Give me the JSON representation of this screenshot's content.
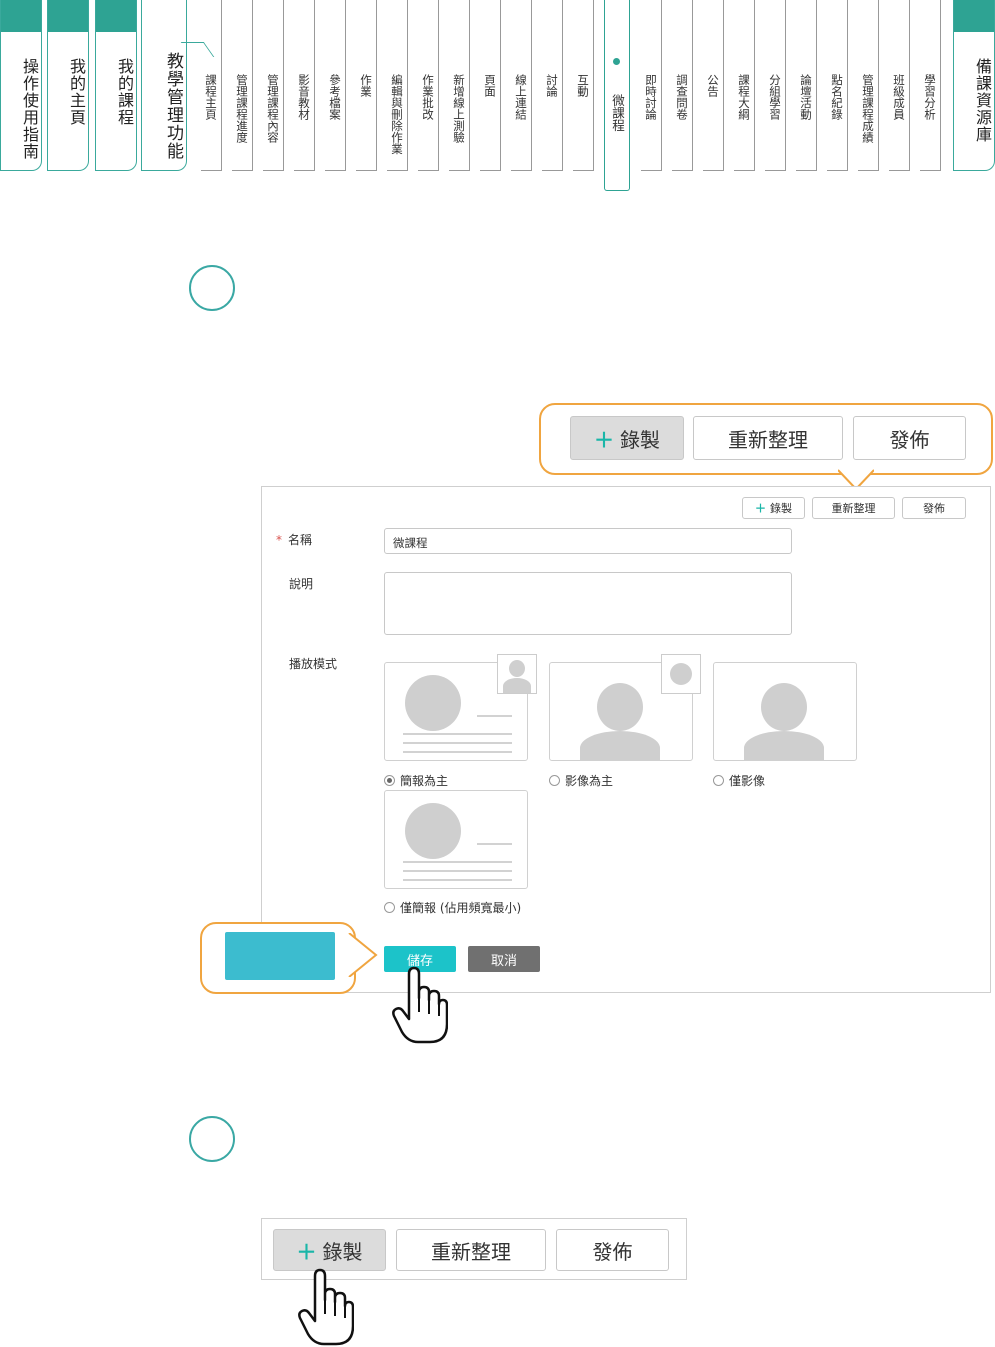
{
  "nav": {
    "main_tabs": [
      "操作使用指南",
      "我的主頁",
      "我的課程",
      "教學管理功能"
    ],
    "sub_tabs": [
      "課程主頁",
      "管理課程進度",
      "管理課程內容",
      "影音教材",
      "參考檔案",
      "作業",
      "編輯與刪除作業",
      "作業批改",
      "新增線上測驗",
      "頁面",
      "線上連結",
      "討論",
      "互動",
      "微課程",
      "即時討論",
      "調查問卷",
      "公告",
      "課程大綱",
      "分組學習",
      "論壇活動",
      "點名紀錄",
      "管理課程成績",
      "班級成員",
      "學習分析"
    ],
    "selected_sub_tab": "微課程",
    "right_tab": "備課資源庫"
  },
  "toolbar": {
    "record": "錄製",
    "reorganize": "重新整理",
    "publish": "發佈"
  },
  "form": {
    "name_label": "名稱",
    "name_value": "微課程",
    "description_label": "說明",
    "description_value": "",
    "play_mode_label": "播放模式",
    "modes": [
      "簡報為主",
      "影像為主",
      "僅影像",
      "僅簡報 (佔用頻寬最小)"
    ],
    "selected_mode": "簡報為主",
    "save": "儲存",
    "cancel": "取消"
  },
  "colors": {
    "accent": "#2ea393",
    "save_button": "#1cc3c9",
    "cancel_button": "#707070",
    "callout_border": "#f0a540",
    "callout_fill": "#3cbccf"
  }
}
